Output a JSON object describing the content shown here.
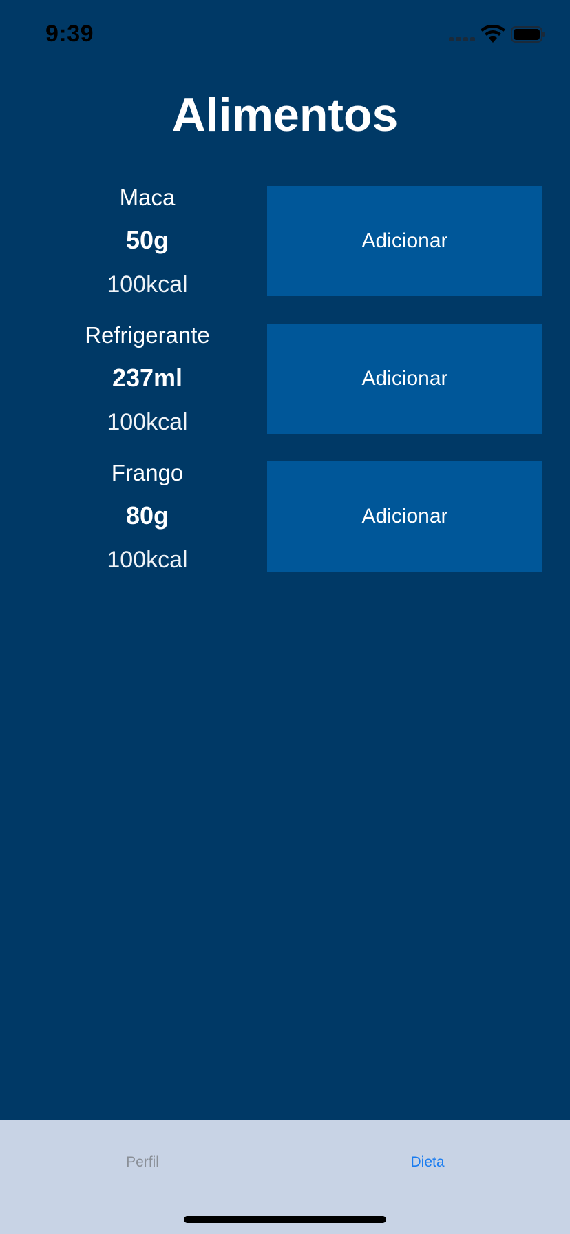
{
  "status_bar": {
    "time": "9:39"
  },
  "page": {
    "title": "Alimentos"
  },
  "foods": [
    {
      "name": "Maca",
      "amount": "50g",
      "kcal": "100kcal",
      "button_label": "Adicionar"
    },
    {
      "name": "Refrigerante",
      "amount": "237ml",
      "kcal": "100kcal",
      "button_label": "Adicionar"
    },
    {
      "name": "Frango",
      "amount": "80g",
      "kcal": "100kcal",
      "button_label": "Adicionar"
    }
  ],
  "tab_bar": {
    "tabs": [
      {
        "label": "Perfil",
        "selected": false
      },
      {
        "label": "Dieta",
        "selected": true
      }
    ]
  },
  "colors": {
    "background": "#003966",
    "button": "#005799",
    "tab_bar": "#c8d3e5",
    "tab_active": "#1a7cf0",
    "tab_inactive": "#8a8f97"
  },
  "icons": [
    "signal-icon",
    "wifi-icon",
    "battery-icon"
  ]
}
